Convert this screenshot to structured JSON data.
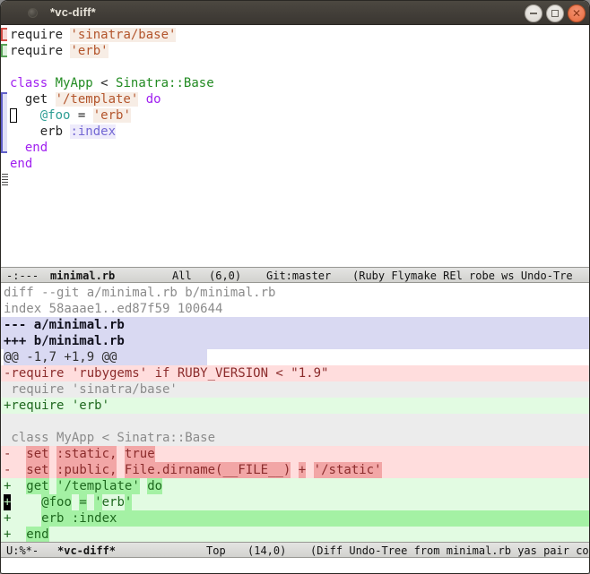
{
  "window": {
    "title": "*vc-diff*",
    "controls": {
      "minimize": "minimize",
      "maximize": "maximize",
      "close": "close"
    }
  },
  "source_buffer": {
    "language": "ruby",
    "fringe_indicators": [
      "removed-bracket-line-1",
      "added-bracket-line-2",
      "changed-bracket-lines-5-8",
      "buffer-end-marks"
    ],
    "cursor": {
      "style": "hollow",
      "line": 6,
      "column": 0
    },
    "lines": [
      {
        "segments": [
          {
            "f": "d",
            "t": "require "
          },
          {
            "f": "s",
            "t": "'sinatra/base'"
          }
        ]
      },
      {
        "segments": [
          {
            "f": "d",
            "t": "require "
          },
          {
            "f": "s",
            "t": "'erb'"
          }
        ]
      },
      {
        "segments": []
      },
      {
        "segments": [
          {
            "f": "k",
            "t": "class"
          },
          {
            "f": "d",
            "t": " "
          },
          {
            "f": "t",
            "t": "MyApp"
          },
          {
            "f": "d",
            "t": " < "
          },
          {
            "f": "t",
            "t": "Sinatra::Base"
          }
        ]
      },
      {
        "segments": [
          {
            "f": "d",
            "t": "  get "
          },
          {
            "f": "s",
            "t": "'/template'"
          },
          {
            "f": "d",
            "t": " "
          },
          {
            "f": "k",
            "t": "do"
          }
        ]
      },
      {
        "segments": [
          {
            "f": "d",
            "t": "    "
          },
          {
            "f": "v",
            "t": "@foo"
          },
          {
            "f": "d",
            "t": " = "
          },
          {
            "f": "s",
            "t": "'erb'"
          }
        ]
      },
      {
        "segments": [
          {
            "f": "d",
            "t": "    erb "
          },
          {
            "f": "y",
            "t": ":index"
          }
        ]
      },
      {
        "segments": [
          {
            "f": "k",
            "t": "  end"
          }
        ]
      },
      {
        "segments": [
          {
            "f": "k",
            "t": "end"
          }
        ]
      }
    ]
  },
  "modeline_source": {
    "status": "-:---",
    "buffer_name": "minimal.rb",
    "scroll": "All",
    "position": "(6,0)",
    "vc": "Git:master",
    "modes": "(Ruby Flymake REl robe ws Undo-Tre"
  },
  "diff_buffer": {
    "cursor": {
      "style": "block",
      "line": 14,
      "column": 0
    },
    "lines": [
      {
        "type": "header",
        "segments": [
          {
            "t": "diff --git a/minimal.rb b/minimal.rb"
          }
        ]
      },
      {
        "type": "header",
        "segments": [
          {
            "t": "index 58aaae1..ed87f59 100644"
          }
        ]
      },
      {
        "type": "file",
        "segments": [
          {
            "t": "--- a/minimal.rb"
          }
        ]
      },
      {
        "type": "file",
        "segments": [
          {
            "t": "+++ b/minimal.rb"
          }
        ]
      },
      {
        "type": "hunk",
        "segments": [
          {
            "t": "@@ -1,7 +1,9 @@"
          }
        ]
      },
      {
        "type": "removed",
        "segments": [
          {
            "t": "-require 'rubygems' if RUBY_VERSION < \"1.9\""
          }
        ]
      },
      {
        "type": "context",
        "segments": [
          {
            "t": " require 'sinatra/base'"
          }
        ]
      },
      {
        "type": "added",
        "segments": [
          {
            "t": "+require 'erb'"
          }
        ]
      },
      {
        "type": "context",
        "segments": [
          {
            "t": ""
          }
        ]
      },
      {
        "type": "context",
        "segments": [
          {
            "t": " class MyApp < Sinatra::Base"
          }
        ]
      },
      {
        "type": "removed",
        "segments": [
          {
            "t": "-  "
          },
          {
            "t": "set",
            "r": true
          },
          {
            "t": " "
          },
          {
            "t": ":static,",
            "r": true
          },
          {
            "t": " "
          },
          {
            "t": "true",
            "r": true
          }
        ]
      },
      {
        "type": "removed",
        "segments": [
          {
            "t": "-  "
          },
          {
            "t": "set",
            "r": true
          },
          {
            "t": " "
          },
          {
            "t": ":public,",
            "r": true
          },
          {
            "t": " "
          },
          {
            "t": "File.dirname(__FILE__)",
            "r": true
          },
          {
            "t": " "
          },
          {
            "t": "+",
            "r": true
          },
          {
            "t": " "
          },
          {
            "t": "'/static'",
            "r": true
          }
        ]
      },
      {
        "type": "added",
        "segments": [
          {
            "t": "+  "
          },
          {
            "t": "get",
            "r": true
          },
          {
            "t": " "
          },
          {
            "t": "'/template'",
            "r": true
          },
          {
            "t": " "
          },
          {
            "t": "do",
            "r": true
          }
        ]
      },
      {
        "type": "added",
        "segments": [
          {
            "t": "+",
            "c": true
          },
          {
            "t": "    "
          },
          {
            "t": "@foo",
            "r": true
          },
          {
            "t": " "
          },
          {
            "t": "=",
            "r": true
          },
          {
            "t": " "
          },
          {
            "t": "'",
            "r": true
          },
          {
            "t": "erb"
          },
          {
            "t": "'",
            "r": true
          }
        ]
      },
      {
        "type": "added",
        "fill": "refine",
        "segments": [
          {
            "t": "+    "
          },
          {
            "t": "erb :index",
            "r": true
          }
        ]
      },
      {
        "type": "added",
        "segments": [
          {
            "t": "+  "
          },
          {
            "t": "end",
            "r": true
          }
        ]
      }
    ]
  },
  "modeline_diff": {
    "status": "U:%*-",
    "buffer_name": "*vc-diff*",
    "scroll": "Top",
    "position": "(14,0)",
    "modes": "(Diff Undo-Tree from minimal.rb yas pair com"
  },
  "echo_area": {
    "text": ""
  },
  "colors": {
    "titlebar_bg": "#3e3a35",
    "close_button": "#e66a3e",
    "keyword": "#a020f0",
    "type": "#228b22",
    "string": "#b3552c",
    "symbol": "#7468d4",
    "variable": "#2f9e94",
    "diff_file_bg": "#d9d9f2",
    "diff_context_bg": "#ececec",
    "diff_removed_bg": "#ffdddd",
    "diff_removed_refine_bg": "#f2a6a6",
    "diff_removed_fg": "#8b2c2c",
    "diff_added_bg": "#e2fbe2",
    "diff_added_refine_bg": "#a4f1a4",
    "diff_added_fg": "#1e681e",
    "modeline_bg": "#d9d9d6"
  }
}
